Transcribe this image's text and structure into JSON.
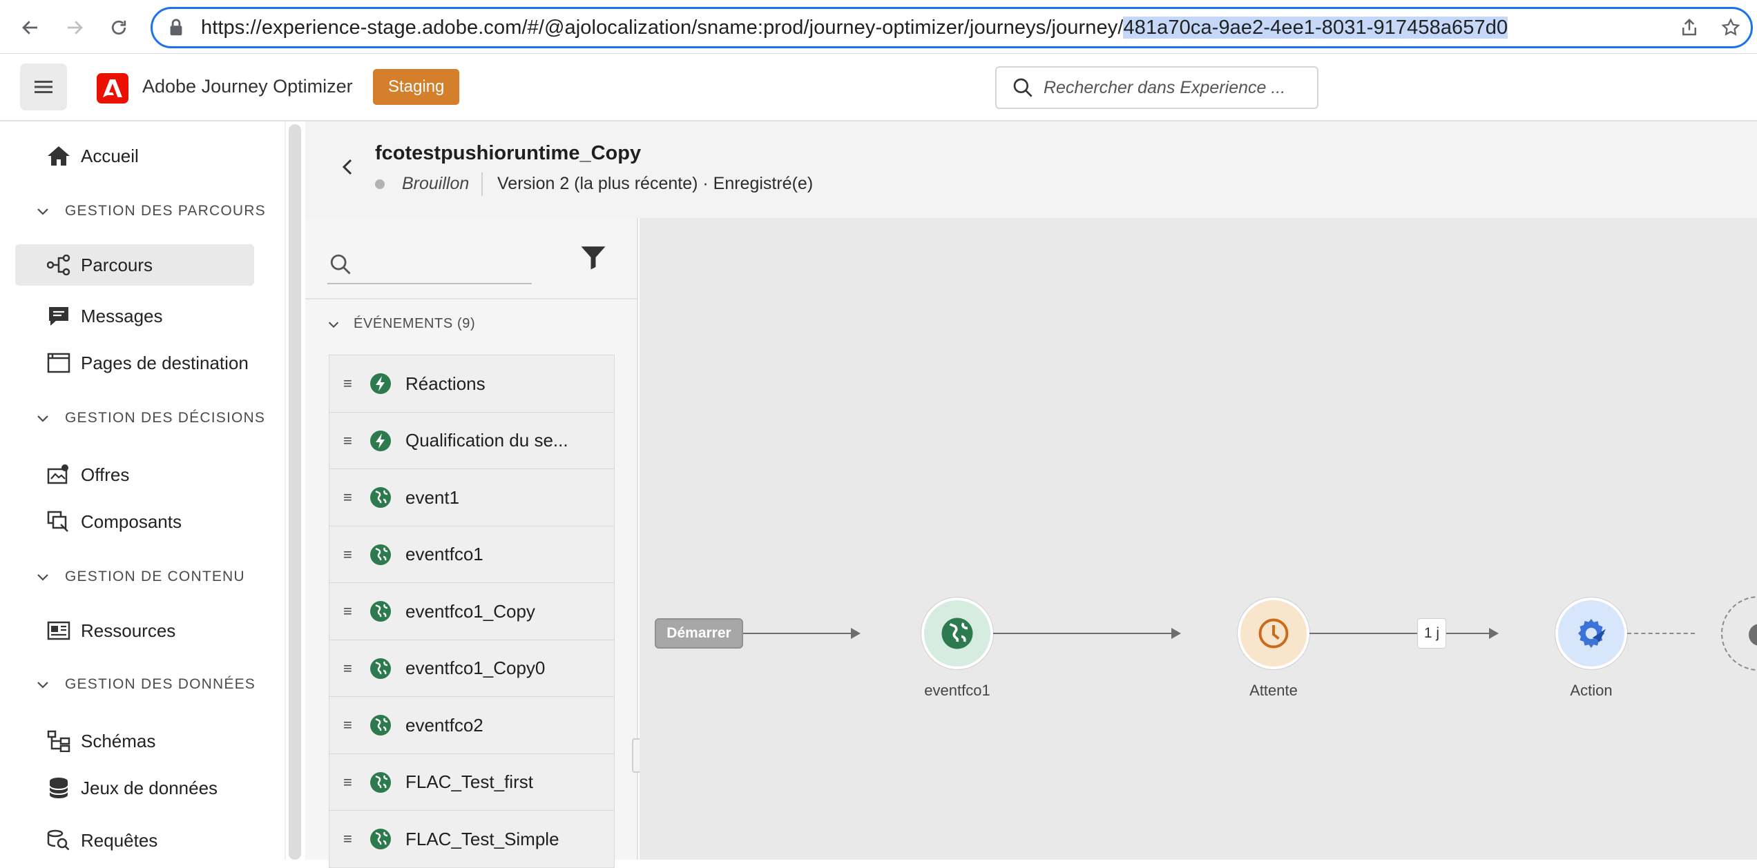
{
  "browser": {
    "url_prefix": "https://experience-stage.adobe.com/#/@ajolocalization/sname:prod/journey-optimizer/journeys/journey/",
    "url_selected": "481a70ca-9ae2-4ee1-8031-917458a657d0"
  },
  "header": {
    "app_name": "Adobe Journey Optimizer",
    "env_badge": "Staging",
    "search_placeholder": "Rechercher dans Experience ..."
  },
  "sidebar": {
    "home": "Accueil",
    "sections": [
      {
        "title": "GESTION DES PARCOURS",
        "items": [
          "Parcours",
          "Messages",
          "Pages de destination"
        ]
      },
      {
        "title": "GESTION DES DÉCISIONS",
        "items": [
          "Offres",
          "Composants"
        ]
      },
      {
        "title": "GESTION DE CONTENU",
        "items": [
          "Ressources"
        ]
      },
      {
        "title": "GESTION DES DONNÉES",
        "items": [
          "Schémas",
          "Jeux de données",
          "Requêtes"
        ]
      }
    ]
  },
  "journey": {
    "title": "fcotestpushioruntime_Copy",
    "status": "Brouillon",
    "version": "Version 2 (la plus récente) · Enregistré(e)"
  },
  "palette": {
    "section_title": "ÉVÉNEMENTS (9)",
    "items": [
      {
        "label": "Réactions",
        "icon": "lightning-icon"
      },
      {
        "label": "Qualification du se...",
        "icon": "lightning-icon"
      },
      {
        "label": "event1",
        "icon": "globe-icon"
      },
      {
        "label": "eventfco1",
        "icon": "globe-icon"
      },
      {
        "label": "eventfco1_Copy",
        "icon": "globe-icon"
      },
      {
        "label": "eventfco1_Copy0",
        "icon": "globe-icon"
      },
      {
        "label": "eventfco2",
        "icon": "globe-icon"
      },
      {
        "label": "FLAC_Test_first",
        "icon": "globe-icon"
      },
      {
        "label": "FLAC_Test_Simple",
        "icon": "globe-icon"
      }
    ]
  },
  "canvas": {
    "start_label": "Démarrer",
    "nodes": [
      {
        "label": "eventfco1",
        "icon": "globe-icon"
      },
      {
        "label": "Attente",
        "icon": "clock-icon"
      },
      {
        "label": "Action",
        "icon": "gear-icon"
      }
    ],
    "wait_duration": "1 j"
  },
  "colors": {
    "accent_blue": "#1a73e8",
    "adobe_red": "#eb1000",
    "staging_orange": "#d37f2c",
    "event_green": "#2d7a4f"
  }
}
